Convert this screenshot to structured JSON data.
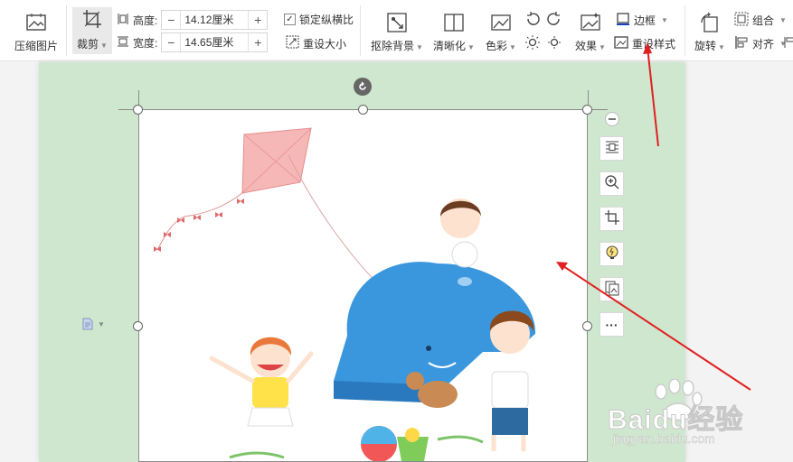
{
  "toolbar": {
    "compress_label": "压缩图片",
    "crop_label": "裁剪",
    "height_label": "高度:",
    "height_value": "14.12厘米",
    "width_label": "宽度:",
    "width_value": "14.65厘米",
    "lock_ratio_label": "锁定纵横比",
    "reset_size_label": "重设大小",
    "remove_bg_label": "抠除背景",
    "sharpen_label": "清晰化",
    "color_label": "色彩",
    "effects_label": "效果",
    "border_label": "边框",
    "reset_style_label": "重设样式",
    "rotate_label": "旋转",
    "group_label": "组合",
    "align_label": "对齐"
  },
  "side_icons": [
    "minus-icon",
    "layout-icon",
    "zoom-icon",
    "crop-icon",
    "idea-icon",
    "convert-icon",
    "more-icon"
  ],
  "more_label": "···",
  "watermark": {
    "text": "Baidu经验",
    "url": "jingyan.baidu.com"
  },
  "colors": {
    "page_bg": "#cfe7cf",
    "accent": "#e02020",
    "app_bg": "#f3f3f3"
  }
}
